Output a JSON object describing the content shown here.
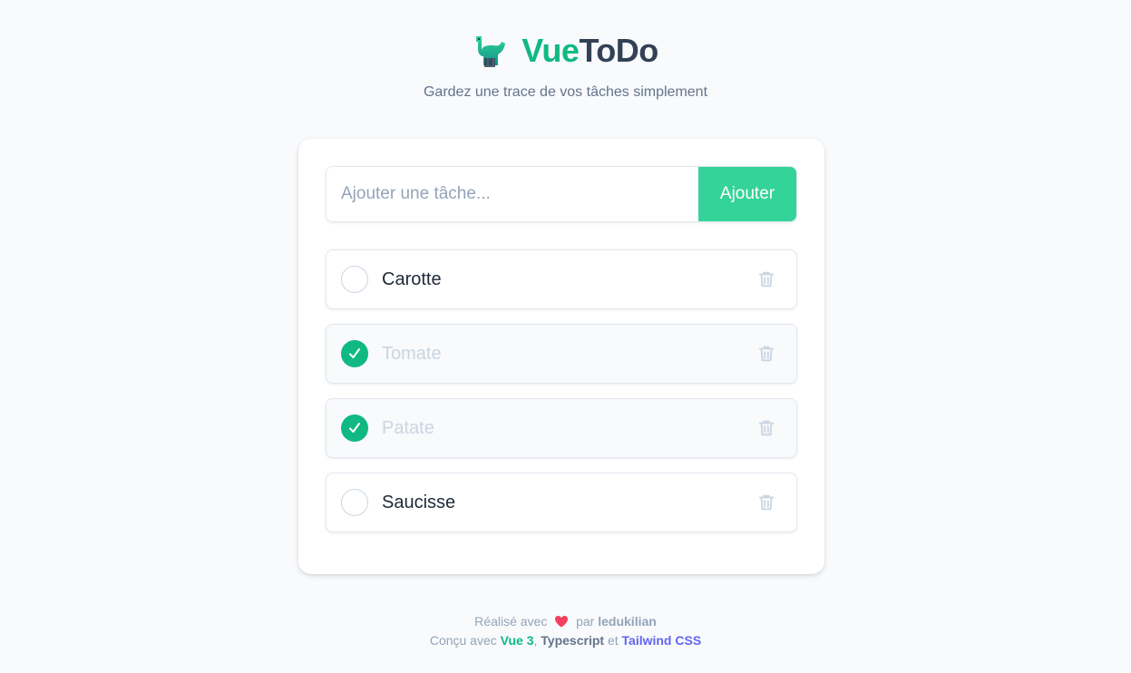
{
  "header": {
    "title_part1": "Vue",
    "title_part2": "ToDo",
    "subtitle": "Gardez une trace de vos tâches simplement",
    "logo_icon": "dinosaur-icon"
  },
  "add_form": {
    "placeholder": "Ajouter une tâche...",
    "value": "",
    "button_label": "Ajouter"
  },
  "todos": [
    {
      "label": "Carotte",
      "done": false
    },
    {
      "label": "Tomate",
      "done": true
    },
    {
      "label": "Patate",
      "done": true
    },
    {
      "label": "Saucisse",
      "done": false
    }
  ],
  "footer": {
    "made_with": "Réalisé avec",
    "by": "par",
    "author": "ledukilian",
    "built_with": "Conçu avec",
    "tech1": "Vue 3",
    "tech2": "Typescript",
    "and": "et",
    "tech3": "Tailwind CSS"
  },
  "colors": {
    "accent": "#10b981",
    "button": "#34d399",
    "tailwind": "#6366f1",
    "heart": "#f43f5e"
  }
}
